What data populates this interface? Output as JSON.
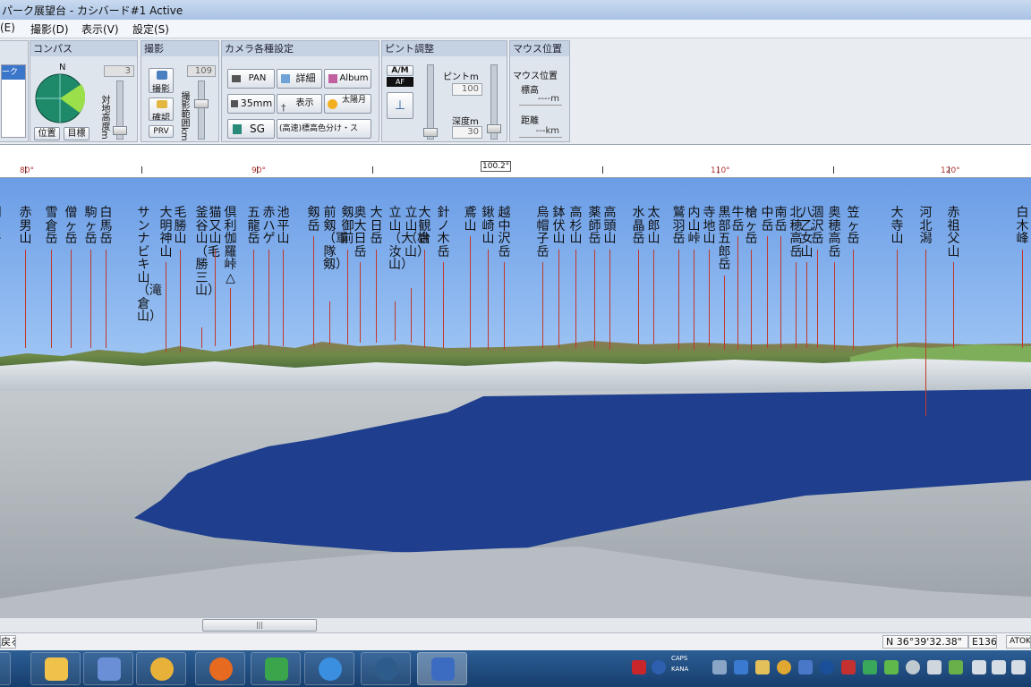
{
  "window": {
    "title": "パーク展望台 - カシバード#1 Active"
  },
  "menu": [
    "(E)",
    "撮影(D)",
    "表示(V)",
    "設定(S)"
  ],
  "panels": {
    "compass": {
      "title": "コンパス",
      "n_label": "N",
      "value": "3",
      "alt_label": "対地高度m",
      "btn_position": "位置",
      "btn_target": "目標"
    },
    "shoot": {
      "title": "撮影",
      "value": "109",
      "btn_shoot": "撮影",
      "btn_confirm": "確認",
      "btn_prv": "PRV",
      "range_label": "撮影範囲km"
    },
    "camera": {
      "title": "カメラ各種設定",
      "btn_pan": "PAN",
      "btn_detail": "詳細",
      "btn_album": "Album",
      "btn_35": "35mm",
      "btn_show": "表示",
      "btn_sun": "太陽月",
      "btn_sg": "SG",
      "btn_color": "(高速)標高色分け・ス"
    },
    "focus": {
      "title": "ピント調整",
      "btn_am": "A/M",
      "af": "AF",
      "pinto_label": "ピントm",
      "pinto_value": "100",
      "depth_label": "深度m",
      "depth_value": "30"
    },
    "mouse": {
      "title": "マウス位置",
      "sub": "マウス位置",
      "alt_label": "標高",
      "alt_value": "----m",
      "dist_label": "距離",
      "dist_value": "---km"
    }
  },
  "ruler": {
    "ticks": [
      "80°",
      "90°",
      "100.2°",
      "110°",
      "120°"
    ]
  },
  "peaks": [
    "明日岳",
    "赤男山",
    "雪倉岳",
    "僧ヶ岳",
    "駒ヶ岳",
    "白馬岳",
    "サンナビキ山（滝倉山）",
    "大明神山",
    "毛勝山",
    "釜谷山（毛勝三山）",
    "猫又山",
    "倶利伽羅峠△",
    "五龍岳",
    "赤ハゲ",
    "池平山",
    "剱岳",
    "前剱（軍隊剱）",
    "剱御前",
    "奥大日岳",
    "大日岳",
    "立山（大汝山）",
    "立山（雄山）",
    "大観台",
    "針ノ木岳",
    "鳶山",
    "鍬崎山",
    "越中沢岳",
    "烏帽子岳",
    "鉢伏山",
    "高杉山",
    "薬師岳",
    "高頭山",
    "水晶岳",
    "太郎山",
    "鷲羽岳",
    "内山峠",
    "寺地山",
    "黒部五郎岳",
    "牛岳",
    "槍ヶ岳",
    "中岳",
    "南岳",
    "北穂高岳",
    "八乙女山",
    "涸沢岳",
    "奥穂高岳",
    "笠ヶ岳",
    "大寺山",
    "河北潟",
    "赤祖父山",
    "白木峰"
  ],
  "status": {
    "left": "戻る",
    "coord_n": "N 36°39'32.38\"",
    "coord_e": "E136",
    "extra": "ATOK"
  },
  "taskbar": {
    "tray_caps": "CAPS",
    "tray_kana": "KANA"
  }
}
